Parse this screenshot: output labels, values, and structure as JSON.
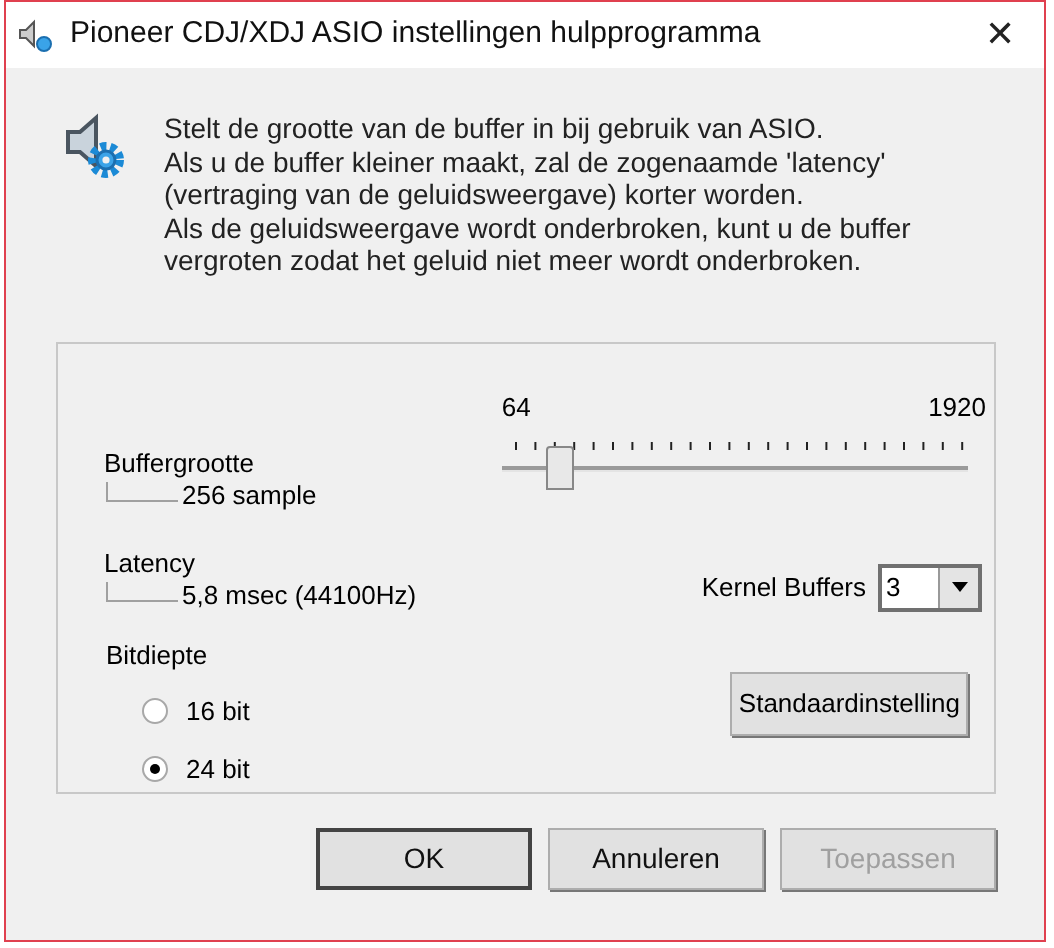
{
  "window": {
    "title": "Pioneer CDJ/XDJ ASIO instellingen hulpprogramma",
    "close": "✕"
  },
  "intro": [
    "Stelt de grootte van de buffer in bij gebruik van ASIO.",
    "Als u de buffer kleiner maakt, zal de zogenaamde 'latency'",
    "(vertraging van de geluidsweergave) korter worden.",
    "Als de geluidsweergave wordt onderbroken, kunt u de buffer",
    "vergroten zodat het geluid niet meer wordt onderbroken."
  ],
  "buffer": {
    "label": "Buffergrootte",
    "value": "256 sample",
    "min": "64",
    "max": "1920",
    "level": 0.1
  },
  "latency": {
    "label": "Latency",
    "value": "5,8 msec (44100Hz)"
  },
  "kernel_buffers": {
    "label": "Kernel Buffers",
    "value": "3"
  },
  "bit_depth": {
    "label": "Bitdiepte",
    "options": [
      {
        "label": "16 bit",
        "selected": false
      },
      {
        "label": "24 bit",
        "selected": true
      }
    ]
  },
  "default_button": "Standaardinstelling",
  "buttons": [
    {
      "label": "OK",
      "default": true,
      "disabled": false
    },
    {
      "label": "Annuleren",
      "default": false,
      "disabled": false
    },
    {
      "label": "Toepassen",
      "default": false,
      "disabled": true
    }
  ]
}
